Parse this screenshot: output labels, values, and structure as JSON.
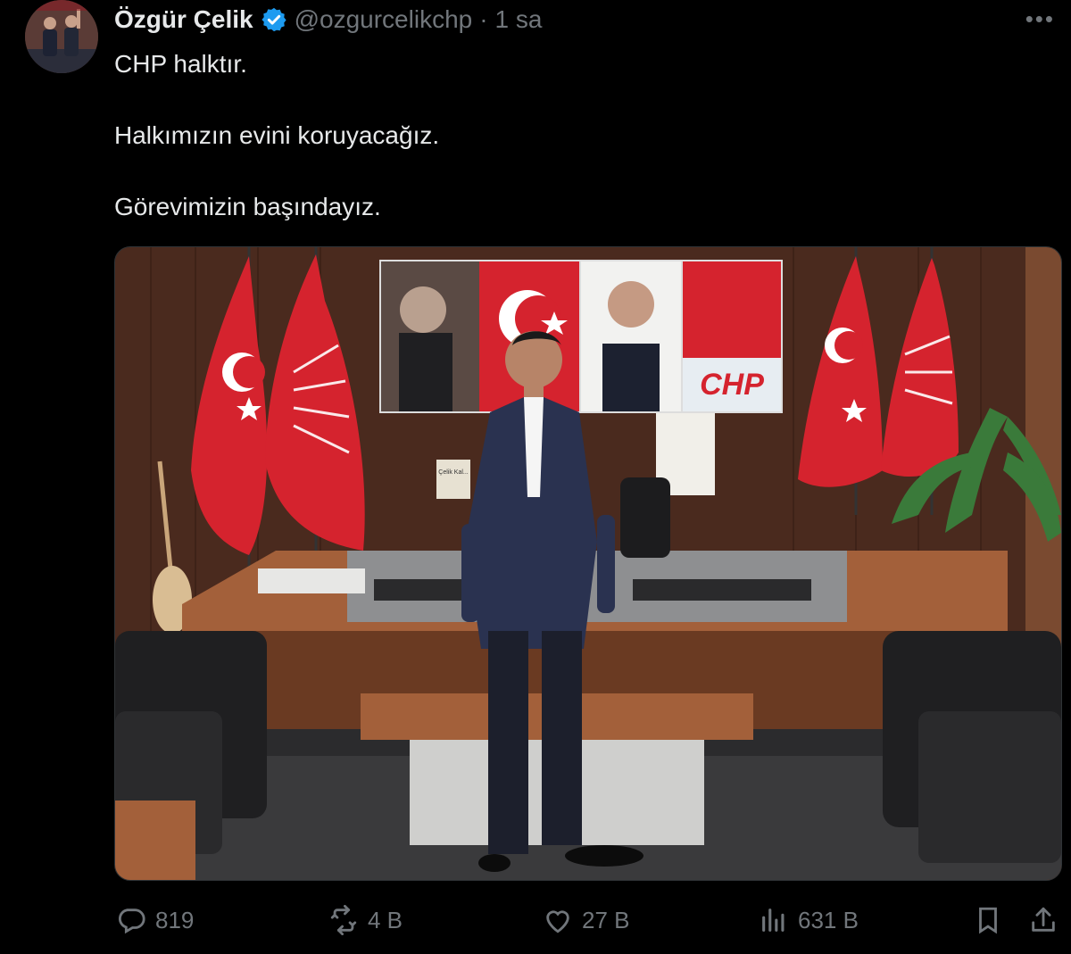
{
  "author": {
    "name": "Özgür Çelik",
    "handle": "@ozgurcelikchp",
    "time_separator": "·",
    "time": "1 sa"
  },
  "tweet": {
    "lines": [
      "CHP halktır.",
      "Halkımızın evini koruyacağız.",
      "Görevimizin başındayız."
    ]
  },
  "photo": {
    "party_logo_text": "CHP",
    "box_label": "Çelik Kal..."
  },
  "actions": {
    "replies": "819",
    "retweets": "4 B",
    "likes": "27 B",
    "views": "631 B"
  },
  "colors": {
    "flag_red": "#d5232e",
    "verified_blue": "#1d9bf0",
    "muted": "#71767b"
  }
}
